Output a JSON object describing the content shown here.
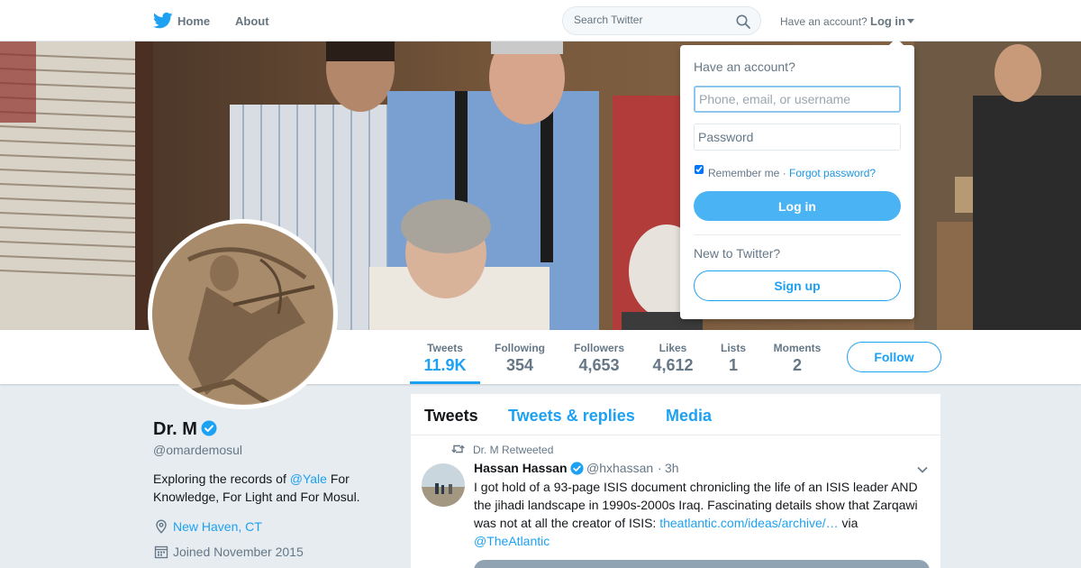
{
  "nav": {
    "home_label": "Home",
    "about_label": "About",
    "search_placeholder": "Search Twitter",
    "account_question": "Have an account?",
    "login_label": "Log in"
  },
  "profile": {
    "name": "Dr. M",
    "handle": "@omardemosul",
    "bio_prefix": "Exploring the records of ",
    "bio_mention": "@Yale",
    "bio_suffix": " For Knowledge, For Light and For Mosul.",
    "location": "New Haven, CT",
    "joined": "Joined November 2015"
  },
  "stats": [
    {
      "label": "Tweets",
      "value": "11.9K"
    },
    {
      "label": "Following",
      "value": "354"
    },
    {
      "label": "Followers",
      "value": "4,653"
    },
    {
      "label": "Likes",
      "value": "4,612"
    },
    {
      "label": "Lists",
      "value": "1"
    },
    {
      "label": "Moments",
      "value": "2"
    }
  ],
  "follow_label": "Follow",
  "timeline": {
    "tabs": [
      "Tweets",
      "Tweets & replies",
      "Media"
    ],
    "retweet_notice": "Dr. M Retweeted",
    "tweet": {
      "author_name": "Hassan Hassan",
      "author_handle": "@hxhassan",
      "separator": "·",
      "time": "3h",
      "text": "I got hold of a 93-page ISIS document chronicling the life of an ISIS leader AND the jihadi landscape in 1990s-2000s Iraq. Fascinating details show that Zarqawi was not at all the creator of ISIS: ",
      "link": "theatlantic.com/ideas/archive/…",
      "via": " via",
      "mention": "@TheAtlantic"
    }
  },
  "login_dropdown": {
    "question": "Have an account?",
    "username_placeholder": "Phone, email, or username",
    "password_placeholder": "Password",
    "remember_label": "Remember me",
    "separator": " · ",
    "forgot_label": "Forgot password?",
    "login_button": "Log in",
    "new_question": "New to Twitter?",
    "signup_button": "Sign up"
  },
  "colors": {
    "accent": "#1da1f2",
    "page_bg": "#e6ecf0",
    "muted": "#657786"
  }
}
